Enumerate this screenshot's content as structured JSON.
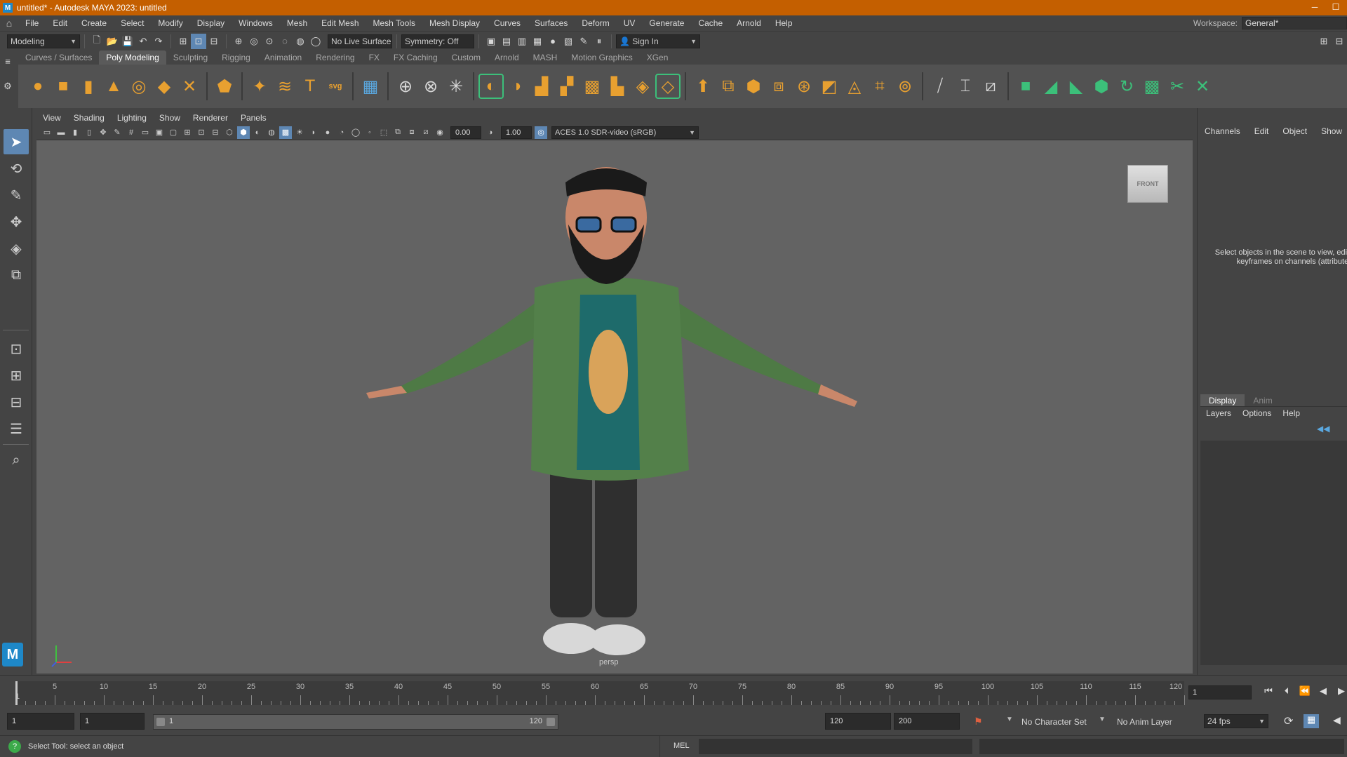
{
  "window": {
    "title": "untitled* - Autodesk MAYA 2023: untitled",
    "minimize": "─",
    "restore": "☐"
  },
  "menu": [
    "File",
    "Edit",
    "Create",
    "Select",
    "Modify",
    "Display",
    "Windows",
    "Mesh",
    "Edit Mesh",
    "Mesh Tools",
    "Mesh Display",
    "Curves",
    "Surfaces",
    "Deform",
    "UV",
    "Generate",
    "Cache",
    "Arnold",
    "Help"
  ],
  "workspace": {
    "label": "Workspace:",
    "value": "General*"
  },
  "status": {
    "menuset": "Modeling",
    "live_surface": "No Live Surface",
    "symmetry": "Symmetry: Off",
    "sign_in": "Sign In"
  },
  "shelf_tabs": [
    "Curves / Surfaces",
    "Poly Modeling",
    "Sculpting",
    "Rigging",
    "Animation",
    "Rendering",
    "FX",
    "FX Caching",
    "Custom",
    "Arnold",
    "MASH",
    "Motion Graphics",
    "XGen"
  ],
  "shelf_active": "Poly Modeling",
  "panel_menu": [
    "View",
    "Shading",
    "Lighting",
    "Show",
    "Renderer",
    "Panels"
  ],
  "panel_toolbar": {
    "exposure": "0.00",
    "gamma": "1.00",
    "colorspace": "ACES 1.0 SDR-video (sRGB)"
  },
  "viewport": {
    "viewcube": "FRONT",
    "camera": "persp"
  },
  "channel_box": {
    "menu": [
      "Channels",
      "Edit",
      "Object",
      "Show"
    ],
    "hint": "Select objects in the scene to view, edit and set keyframes on channels (attributes)"
  },
  "layer_editor": {
    "tabs": [
      "Display",
      "Anim"
    ],
    "active": "Display",
    "menu": [
      "Layers",
      "Options",
      "Help"
    ]
  },
  "time_slider": {
    "labels": [
      "5",
      "10",
      "15",
      "20",
      "25",
      "30",
      "35",
      "40",
      "45",
      "50",
      "55",
      "60",
      "65",
      "70",
      "75",
      "80",
      "85",
      "90",
      "95",
      "100",
      "105",
      "110",
      "115",
      "120"
    ],
    "start": 1,
    "end": 120,
    "current_frame": "1",
    "first_label": "1"
  },
  "range": {
    "start": "1",
    "playback_start": "1",
    "slider_start": "1",
    "slider_end": "120",
    "playback_end": "120",
    "end": "200",
    "character_set": "No Character Set",
    "anim_layer": "No Anim Layer",
    "fps": "24 fps"
  },
  "command": {
    "help": "Select Tool: select an object",
    "lang": "MEL"
  },
  "colors": {
    "titlebar": "#c45f00",
    "accent": "#5e87b3",
    "shelf_icon": "#e8a030"
  }
}
